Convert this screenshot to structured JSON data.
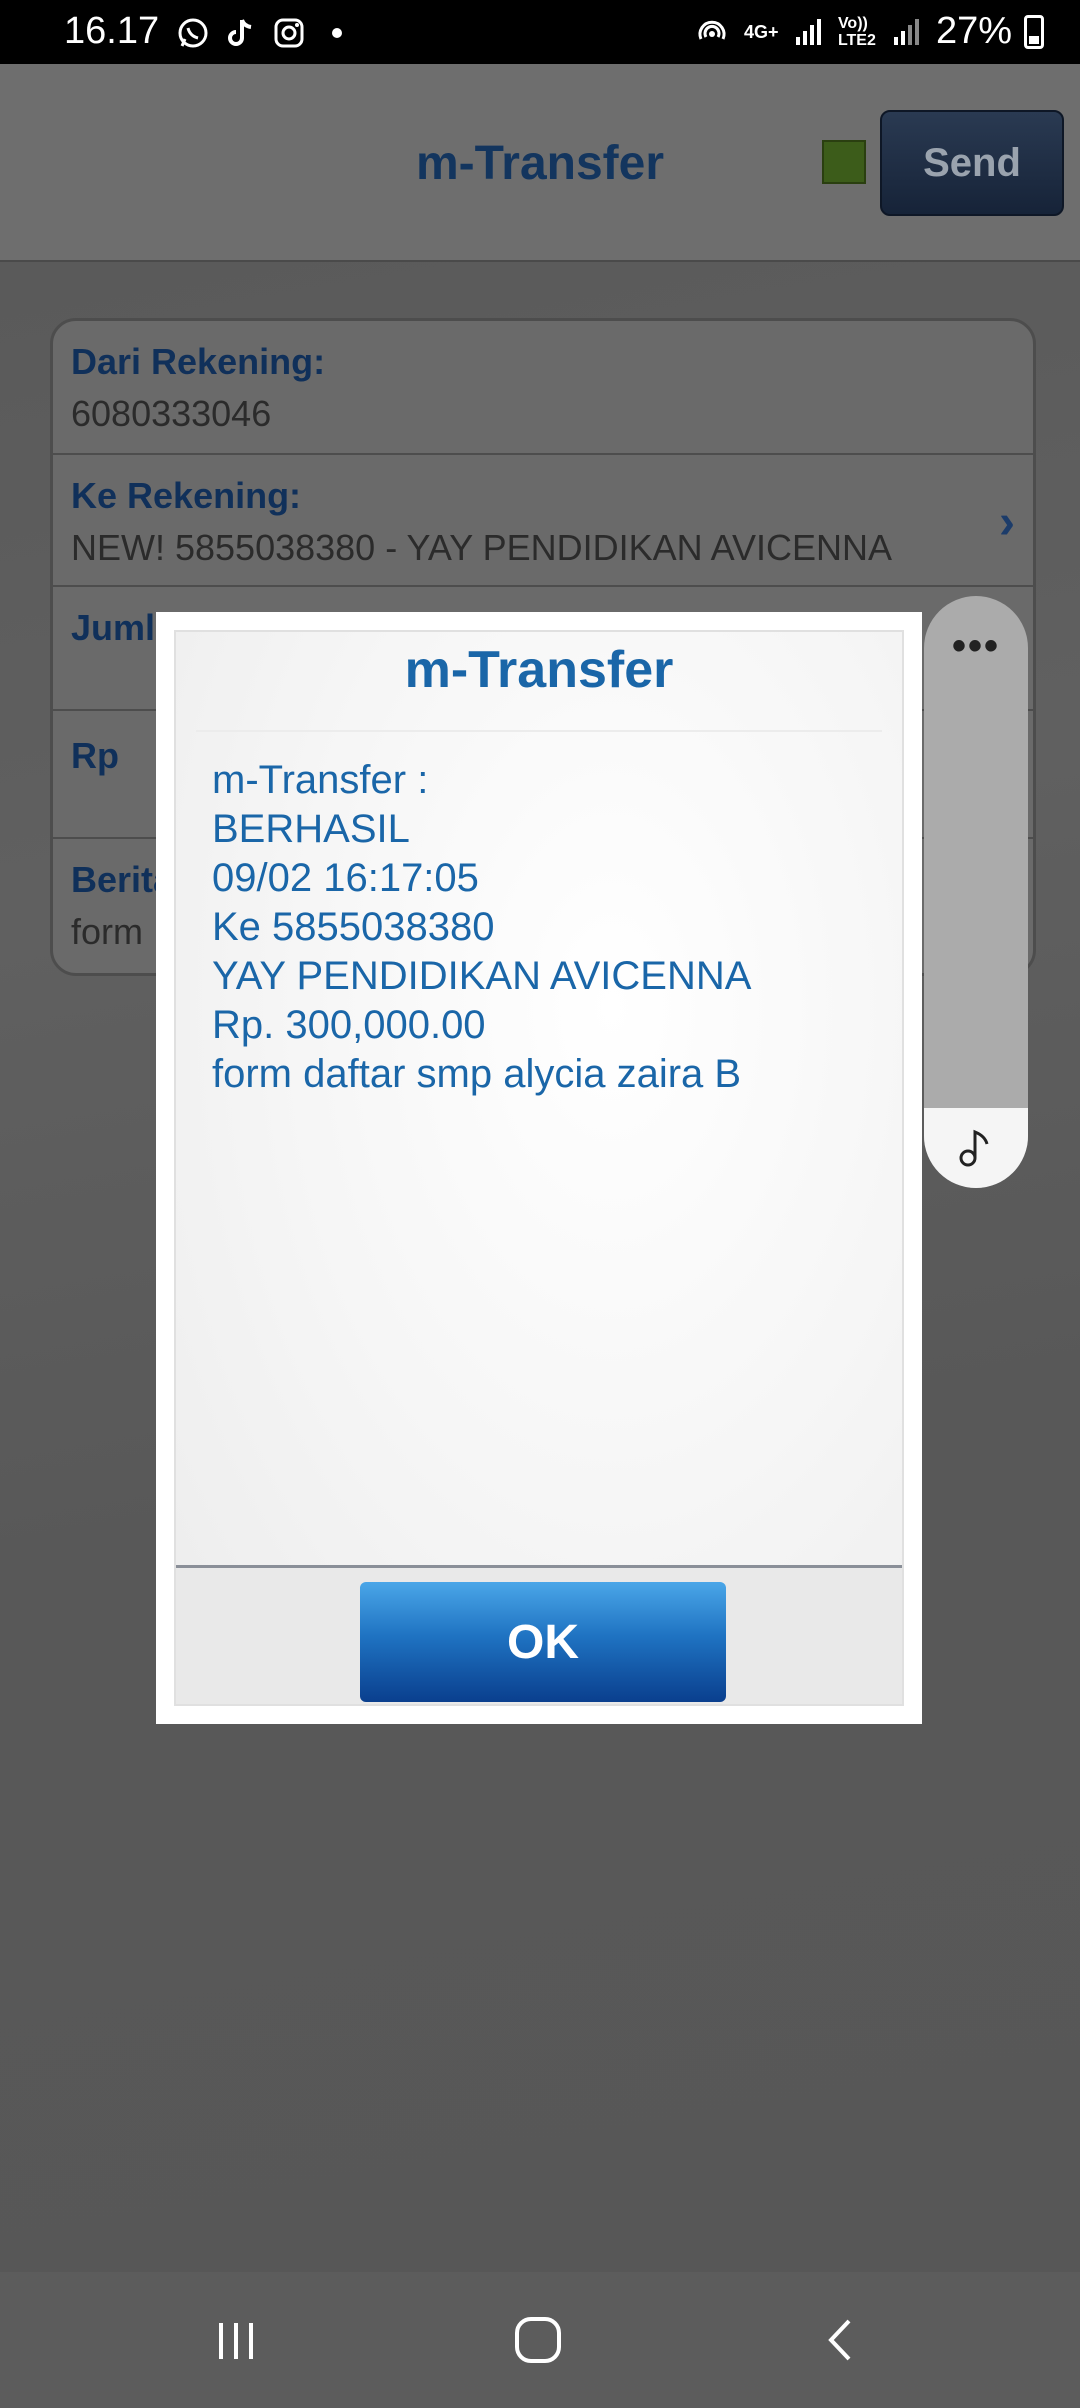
{
  "status_bar": {
    "time": "16.17",
    "battery": "27%",
    "notification_icons": [
      "whatsapp-icon",
      "tiktok-icon",
      "instagram-icon",
      "dot-icon"
    ],
    "system_icons": [
      "hotspot-icon",
      "4g-icon",
      "signal-icon",
      "volte-icon",
      "signal-icon",
      "battery-icon"
    ],
    "network_label": "4G+",
    "volte_label": "Vo)) LTE2"
  },
  "app_bar": {
    "title": "m-Transfer",
    "send_label": "Send",
    "indicator_color": "#3c5c1a"
  },
  "form": {
    "fields": [
      {
        "label": "Dari Rekening:",
        "value": "6080333046"
      },
      {
        "label": "Ke Rekening:",
        "value": "NEW! 5855038380 - YAY PENDIDIKAN AVICENNA"
      },
      {
        "label": "Juml",
        "value": ""
      },
      {
        "label": "Rp",
        "value": ""
      },
      {
        "label": "Berita",
        "value": "form"
      }
    ]
  },
  "dialog": {
    "title": "m-Transfer",
    "lines": [
      "m-Transfer :",
      "BERHASIL",
      "09/02 16:17:05",
      "Ke 5855038380",
      "YAY PENDIDIKAN AVICENNA",
      "Rp. 300,000.00",
      "form daftar smp alycia zaira B"
    ],
    "ok_label": "OK",
    "text_color": "#1a66a8"
  },
  "side_panel": {
    "menu_icon": "more-dots-icon",
    "music_icon": "music-note-icon"
  },
  "nav_bar": {
    "buttons": [
      "recent-apps-icon",
      "home-icon",
      "back-icon"
    ]
  }
}
